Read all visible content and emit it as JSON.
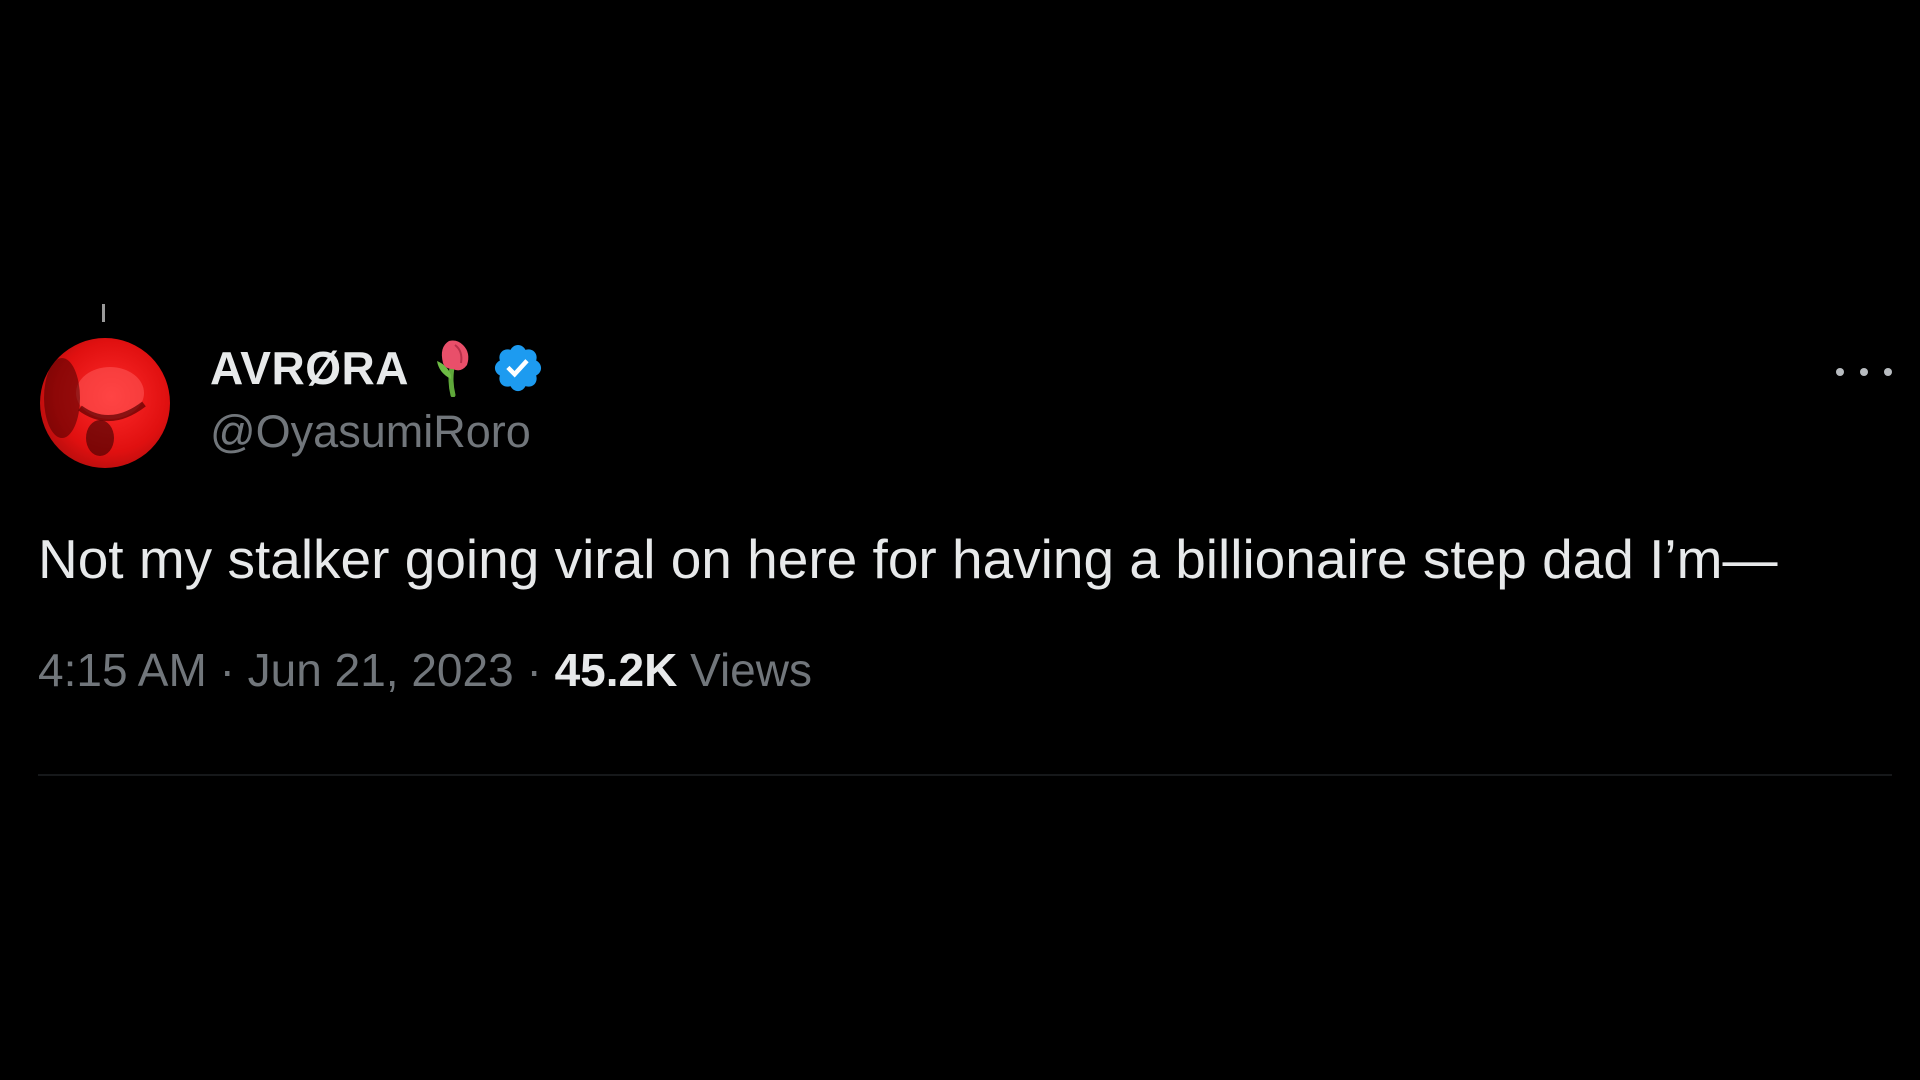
{
  "tweet": {
    "author": {
      "display_name": "AVRØRA",
      "handle": "@OyasumiRoro",
      "name_emoji_icon": "wilted-rose-icon",
      "verified_icon": "verified-badge-icon",
      "verified_color": "#1d9bf0"
    },
    "avatar": {
      "icon": "avatar-photo",
      "color": "#e01010"
    },
    "more_icon": "more-options-icon",
    "text": "Not my stalker going viral on here for having a billionaire step dad I’m—",
    "meta": {
      "time": "4:15 AM",
      "separator": "·",
      "date": "Jun 21, 2023",
      "views_count": "45.2K",
      "views_label": "Views"
    }
  },
  "colors": {
    "background": "#000000",
    "primary_text": "#e7e9ea",
    "secondary_text": "#71767b",
    "divider": "#16181a"
  }
}
